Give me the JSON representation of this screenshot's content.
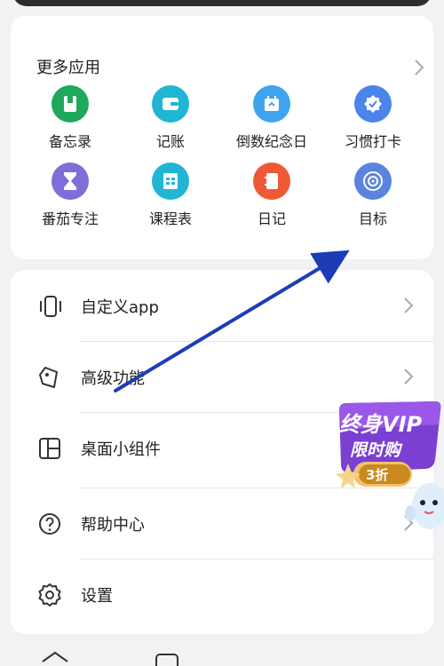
{
  "more_apps": {
    "title": "更多应用",
    "items": [
      {
        "label": "备忘录",
        "icon": "memo-icon",
        "color": "#1fa85c"
      },
      {
        "label": "记账",
        "icon": "wallet-icon",
        "color": "#21b5d4"
      },
      {
        "label": "倒数纪念日",
        "icon": "calendar-icon",
        "color": "#3ea4f0"
      },
      {
        "label": "习惯打卡",
        "icon": "badge-check-icon",
        "color": "#4b84ea"
      },
      {
        "label": "番茄专注",
        "icon": "hourglass-icon",
        "color": "#7f6ed9"
      },
      {
        "label": "课程表",
        "icon": "timetable-icon",
        "color": "#21b5d4"
      },
      {
        "label": "日记",
        "icon": "diary-icon",
        "color": "#ee5a35"
      },
      {
        "label": "目标",
        "icon": "target-icon",
        "color": "#5a84de"
      }
    ]
  },
  "menu": {
    "items": [
      {
        "label": "自定义app",
        "icon": "phone-vibrate-icon"
      },
      {
        "label": "高级功能",
        "icon": "tag-icon"
      },
      {
        "label": "桌面小组件",
        "icon": "widget-icon"
      },
      {
        "label": "帮助中心",
        "icon": "help-icon"
      },
      {
        "label": "设置",
        "icon": "settings-icon"
      }
    ]
  },
  "promo": {
    "line1": "终身VIP",
    "line2": "限时购",
    "line3": "3折",
    "color": "#7b3fd1"
  },
  "annotation": {
    "arrow_color": "#1c3db5"
  }
}
